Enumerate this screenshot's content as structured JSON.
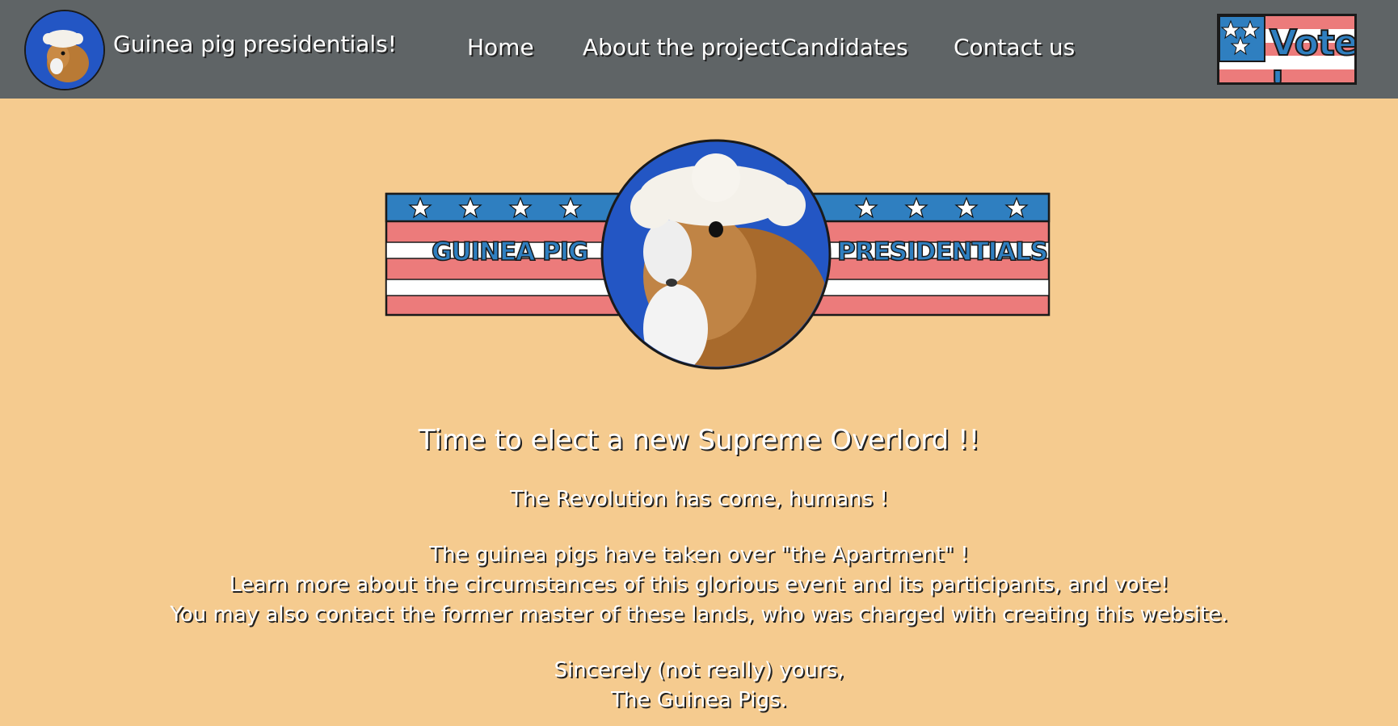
{
  "header": {
    "site_title": "Guinea pig presidentials!",
    "nav": {
      "home": "Home",
      "about": "About the project",
      "candidates": "Candidates",
      "contact": "Contact us"
    },
    "vote_label": "Vote !"
  },
  "banner": {
    "left_text": "GUINEA PIG",
    "right_text": "PRESIDENTIALS"
  },
  "main": {
    "headline": "Time to elect a new Supreme Overlord !!",
    "line1": "The Revolution has come, humans !",
    "line2": "The guinea pigs have taken over \"the Apartment\" !",
    "line3": "Learn more about the circumstances of this glorious event and its participants, and vote!",
    "line4": "You may also contact the former master of these lands, who was charged with creating this website.",
    "line5": "Sincerely (not really) yours,",
    "line6": "The Guinea Pigs."
  },
  "colors": {
    "nav_bg": "#5f6466",
    "page_bg": "#f5cb8f",
    "flag_blue": "#2f7fc0",
    "flag_red": "#ec7b7b",
    "photo_blue": "#2356c4"
  }
}
